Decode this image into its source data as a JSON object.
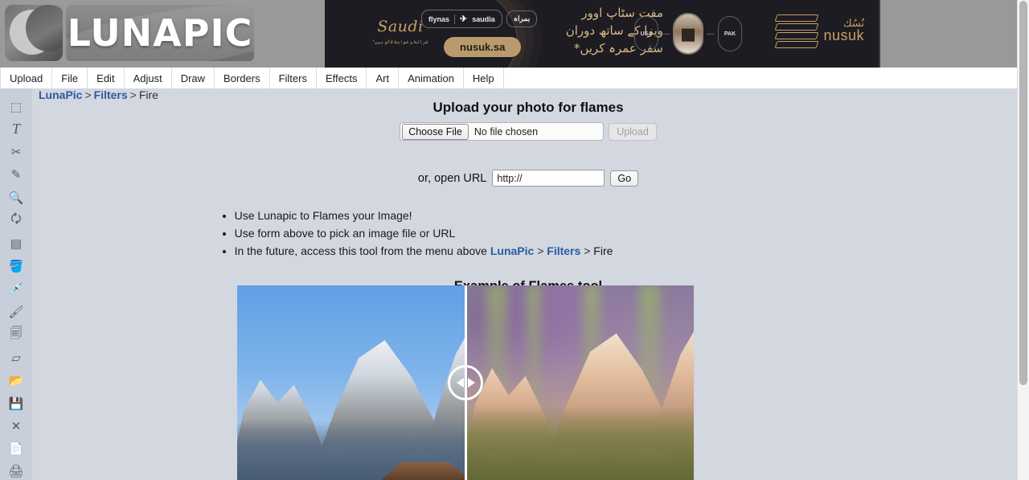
{
  "site": {
    "logo_text": "LUNAPIC"
  },
  "ad": {
    "brand_script": "Saudi",
    "brand_sub": "*شرائط و ضوابط لاگو ہیں",
    "partner_left": "flynas",
    "partner_right": "saudia",
    "partner_with": "بمراہ",
    "cta": "nusuk.sa",
    "headline_line1": "مفت سٹاپ اوور",
    "headline_line2": "ویزا کے ساتھ دوران",
    "headline_line3": "سفر عمرہ کریں*",
    "route_from": "USA",
    "route_to": "PAK",
    "logo_ar": "نُسُك",
    "logo_en": "nusuk"
  },
  "menu": {
    "items": [
      {
        "label": "Upload",
        "name": "menu-upload"
      },
      {
        "label": "File",
        "name": "menu-file"
      },
      {
        "label": "Edit",
        "name": "menu-edit"
      },
      {
        "label": "Adjust",
        "name": "menu-adjust"
      },
      {
        "label": "Draw",
        "name": "menu-draw"
      },
      {
        "label": "Borders",
        "name": "menu-borders"
      },
      {
        "label": "Filters",
        "name": "menu-filters"
      },
      {
        "label": "Effects",
        "name": "menu-effects"
      },
      {
        "label": "Art",
        "name": "menu-art"
      },
      {
        "label": "Animation",
        "name": "menu-animation"
      },
      {
        "label": "Help",
        "name": "menu-help"
      }
    ]
  },
  "breadcrumb": {
    "root": "LunaPic",
    "sep1": ">",
    "category": "Filters",
    "sep2": ">",
    "current": "Fire"
  },
  "toolbar": {
    "icons": [
      {
        "name": "select-marquee-icon",
        "glyph": "⬚"
      },
      {
        "name": "text-tool-icon",
        "glyph": "T"
      },
      {
        "name": "scissors-crop-icon",
        "glyph": "✂"
      },
      {
        "name": "pencil-tool-icon",
        "glyph": "✎"
      },
      {
        "name": "magnifier-zoom-icon",
        "glyph": "🔍"
      },
      {
        "name": "rotate-refresh-icon",
        "glyph": "🗘"
      },
      {
        "name": "gradient-tool-icon",
        "glyph": "▤"
      },
      {
        "name": "paint-bucket-icon",
        "glyph": "🪣"
      },
      {
        "name": "eyedropper-icon",
        "glyph": "💉"
      },
      {
        "name": "paintbrush-icon",
        "glyph": "🖌"
      },
      {
        "name": "copy-layers-icon",
        "glyph": "🗐"
      },
      {
        "name": "eraser-icon",
        "glyph": "▱"
      },
      {
        "name": "open-folder-icon",
        "glyph": "📂"
      },
      {
        "name": "save-floppy-icon",
        "glyph": "💾"
      },
      {
        "name": "close-x-icon",
        "glyph": "✕"
      },
      {
        "name": "new-document-icon",
        "glyph": "📄"
      },
      {
        "name": "print-icon",
        "glyph": "🖨"
      }
    ]
  },
  "upload": {
    "title": "Upload your photo for flames",
    "choose_file_label": "Choose File",
    "file_status": "No file chosen",
    "upload_button": "Upload",
    "url_label": "or, open URL",
    "url_value": "http://",
    "url_placeholder": "http://",
    "go_button": "Go"
  },
  "tips": {
    "item1": "Use Lunapic to Flames your Image!",
    "item2": "Use form above to pick an image file or URL",
    "item3_pre": "In the future, access this tool from the menu above ",
    "item3_link1": "LunaPic",
    "item3_sep1": " > ",
    "item3_link2": "Filters",
    "item3_sep2": " > ",
    "item3_post": "Fire"
  },
  "example": {
    "title": "Example of Flames tool",
    "before_alt": "Grand Teton mountains with blue sky",
    "after_alt": "Grand Teton mountains with flames filter applied"
  },
  "colors": {
    "link": "#2b5b9e",
    "page_bg": "#d3d7e0",
    "toolrail_bg": "#c9cedb",
    "topbar_bg": "#999999",
    "ad_bg": "#1c1c22",
    "ad_gold": "#c9a164"
  }
}
